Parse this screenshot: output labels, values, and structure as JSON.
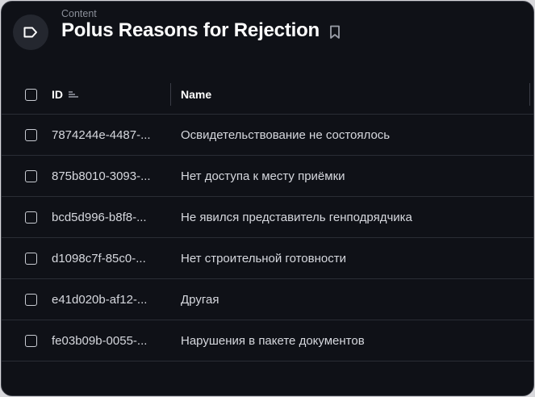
{
  "header": {
    "breadcrumb": "Content",
    "title": "Polus Reasons for Rejection",
    "collection_icon": "tag-icon",
    "bookmark_icon": "bookmark-icon"
  },
  "table": {
    "columns": [
      {
        "label": "ID",
        "sort_icon": "sort-icon"
      },
      {
        "label": "Name"
      }
    ],
    "rows": [
      {
        "id": "7874244e-4487-...",
        "name": "Освидетельствование не состоялось"
      },
      {
        "id": "875b8010-3093-...",
        "name": "Нет доступа к месту приёмки"
      },
      {
        "id": "bcd5d996-b8f8-...",
        "name": "Не явился представитель генподрядчика"
      },
      {
        "id": "d1098c7f-85c0-...",
        "name": "Нет строительной готовности"
      },
      {
        "id": "e41d020b-af12-...",
        "name": "Другая"
      },
      {
        "id": "fe03b09b-0055-...",
        "name": "Нарушения в пакете документов"
      }
    ]
  },
  "colors": {
    "background": "#0f1117",
    "text": "#d6d8de",
    "muted": "#8b8f99",
    "divider": "#2a2d35"
  }
}
